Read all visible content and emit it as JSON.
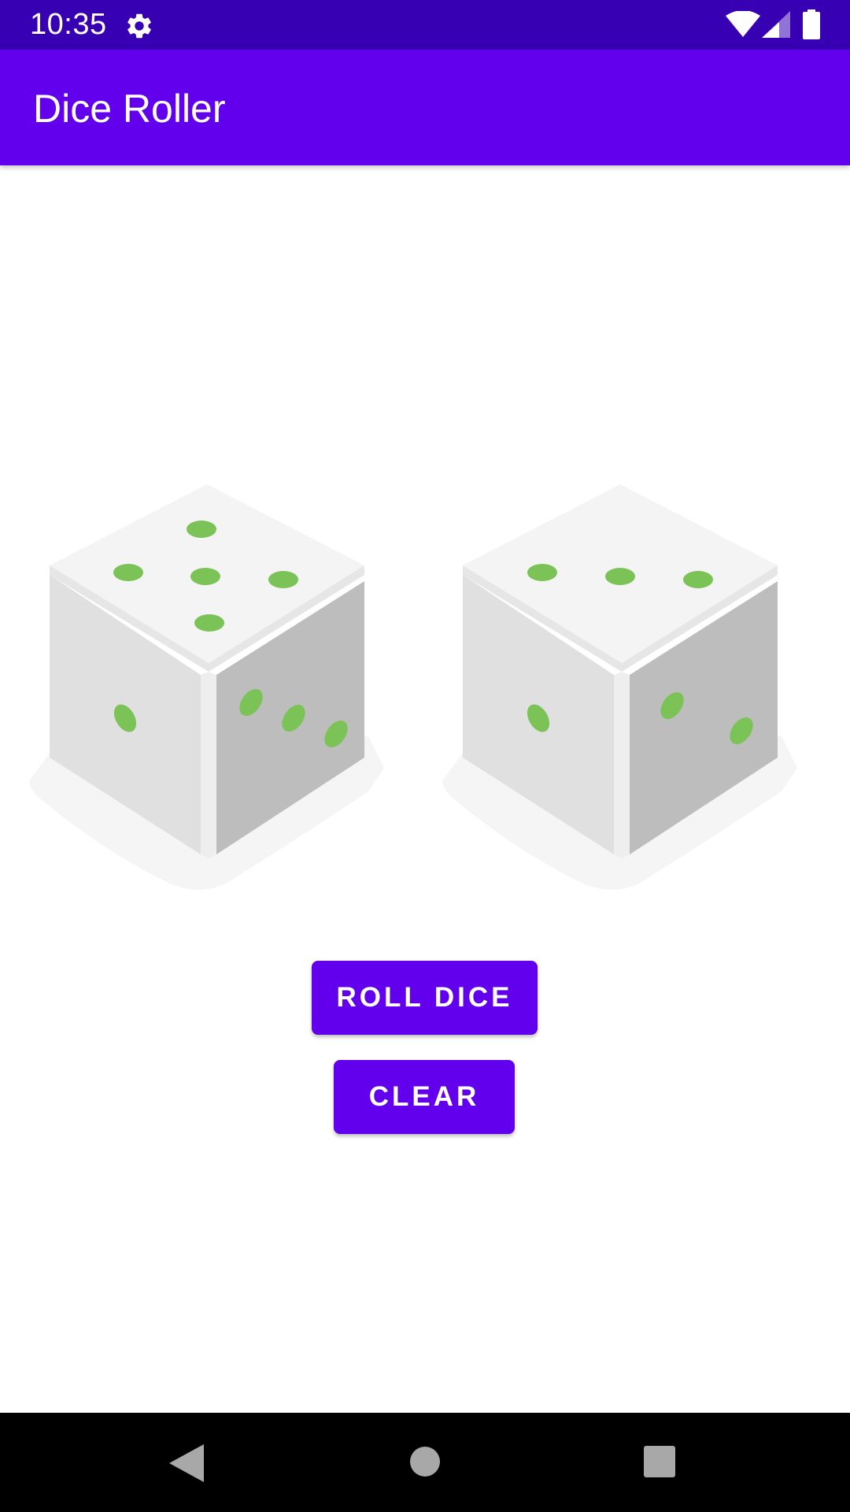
{
  "status_bar": {
    "time": "10:35",
    "icons": [
      "gear-icon",
      "wifi-icon",
      "signal-icon",
      "battery-icon"
    ]
  },
  "app_bar": {
    "title": "Dice Roller"
  },
  "dice": [
    {
      "name": "die-left",
      "top_face_pips": 5,
      "left_face_pips": 1,
      "right_face_pips": 3
    },
    {
      "name": "die-right",
      "top_face_pips": 3,
      "left_face_pips": 1,
      "right_face_pips": 2
    }
  ],
  "buttons": {
    "roll_label": "ROLL DICE",
    "clear_label": "CLEAR"
  },
  "nav_bar": {
    "icons": [
      "back-icon",
      "home-icon",
      "recents-icon"
    ]
  },
  "colors": {
    "status_bar": "#3700b3",
    "primary": "#6200ee",
    "pip": "#7bc356",
    "die_top": "#f4f4f4",
    "die_left": "#e0e0e0",
    "die_right": "#bdbdbd",
    "nav_bar": "#000000"
  }
}
